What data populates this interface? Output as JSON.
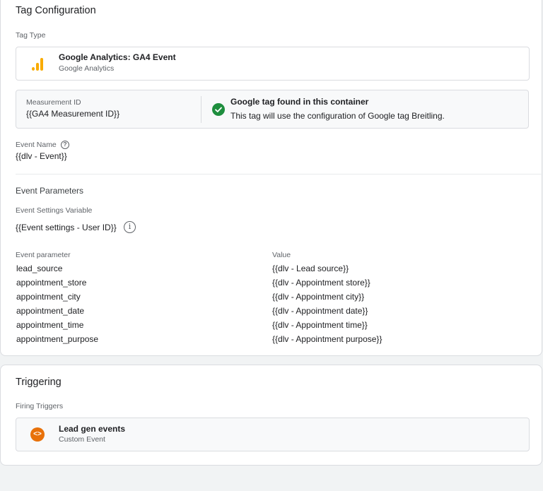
{
  "tag_configuration": {
    "title": "Tag Configuration",
    "tag_type_label": "Tag Type",
    "tag_type": {
      "name": "Google Analytics: GA4 Event",
      "subtitle": "Google Analytics",
      "icon": "google-analytics-bars-icon",
      "icon_color": "#f9ab00"
    },
    "measurement": {
      "label": "Measurement ID",
      "value": "{{GA4 Measurement ID}}",
      "status_title": "Google tag found in this container",
      "status_message": "This tag will use the configuration of Google tag Breitling.",
      "status_icon": "check-circle-icon",
      "status_color": "#1e8e3e"
    },
    "event_name": {
      "label": "Event Name",
      "value": "{{dlv - Event}}",
      "help_icon": "help-icon"
    },
    "event_parameters": {
      "title": "Event Parameters",
      "settings_variable_label": "Event Settings Variable",
      "settings_variable_value": "{{Event settings - User ID}}",
      "column_param": "Event parameter",
      "column_value": "Value",
      "rows": [
        {
          "name": "lead_source",
          "value": "{{dlv - Lead source}}"
        },
        {
          "name": "appointment_store",
          "value": "{{dlv - Appointment store}}"
        },
        {
          "name": "appointment_city",
          "value": "{{dlv - Appointment city}}"
        },
        {
          "name": "appointment_date",
          "value": "{{dlv - Appointment date}}"
        },
        {
          "name": "appointment_time",
          "value": "{{dlv - Appointment time}}"
        },
        {
          "name": "appointment_purpose",
          "value": "{{dlv - Appointment purpose}}"
        }
      ]
    }
  },
  "triggering": {
    "title": "Triggering",
    "firing_label": "Firing Triggers",
    "triggers": [
      {
        "name": "Lead gen events",
        "type": "Custom Event",
        "icon": "code-brackets-icon",
        "icon_color": "#e8710a"
      }
    ]
  }
}
